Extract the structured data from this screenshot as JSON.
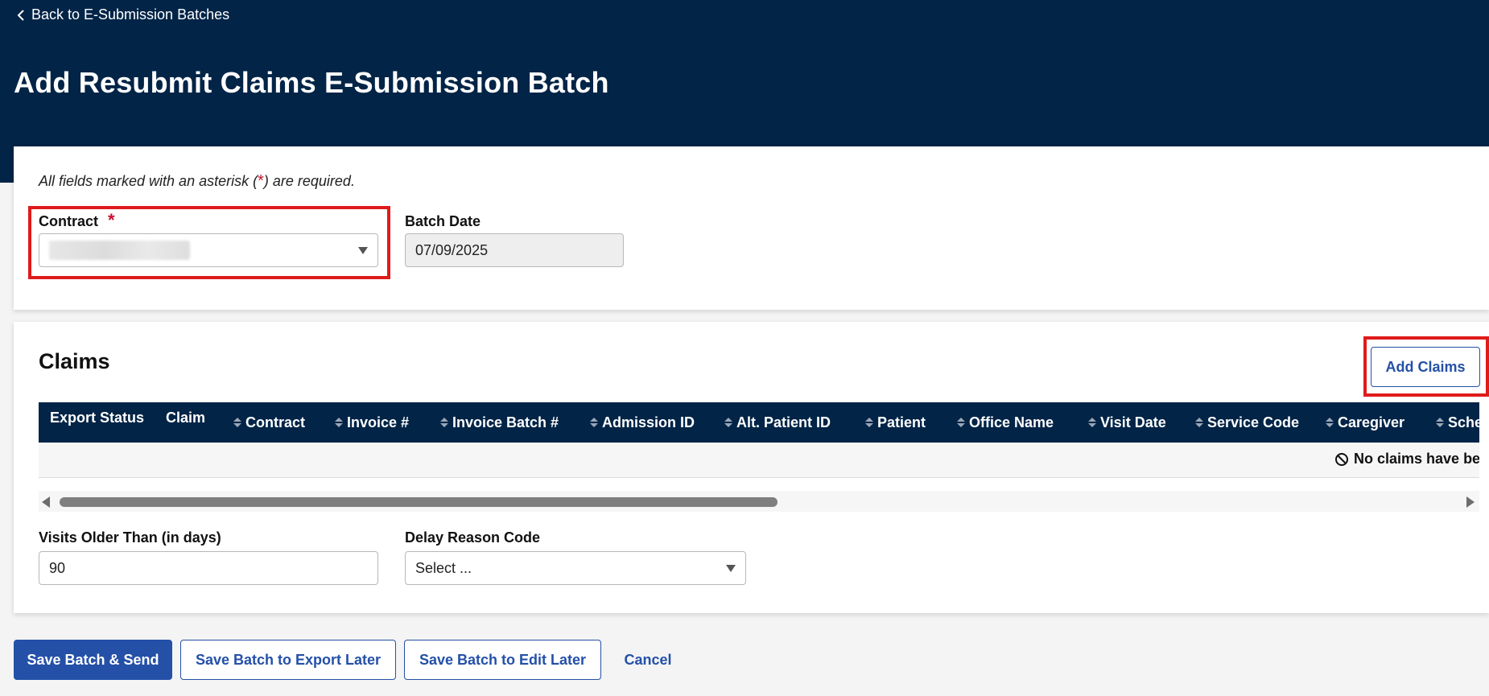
{
  "header": {
    "back_link": "Back to E-Submission Batches",
    "title": "Add Resubmit Claims E-Submission Batch"
  },
  "form": {
    "required_note_prefix": "All fields marked with an asterisk (",
    "required_note_asterisk": "*",
    "required_note_suffix": ") are required.",
    "contract_label": "Contract",
    "contract_required": "*",
    "contract_value": "",
    "batch_date_label": "Batch Date",
    "batch_date_value": "07/09/2025"
  },
  "claims": {
    "title": "Claims",
    "add_button": "Add Claims",
    "columns": [
      "Export Status",
      "Claim",
      "Contract",
      "Invoice #",
      "Invoice Batch #",
      "Admission ID",
      "Alt. Patient ID",
      "Patient",
      "Office Name",
      "Visit Date",
      "Service Code",
      "Caregiver",
      "Sche"
    ],
    "empty_message": "No claims have be",
    "visits_older_label": "Visits Older Than (in days)",
    "visits_older_value": "90",
    "delay_reason_label": "Delay Reason Code",
    "delay_reason_value": "Select ..."
  },
  "footer": {
    "save_send": "Save Batch & Send",
    "save_export_later": "Save Batch to Export Later",
    "save_edit_later": "Save Batch to Edit Later",
    "cancel": "Cancel"
  },
  "colors": {
    "navy": "#012447",
    "primary": "#2450a8",
    "required": "#c8102e",
    "highlight": "#e01b1b"
  }
}
